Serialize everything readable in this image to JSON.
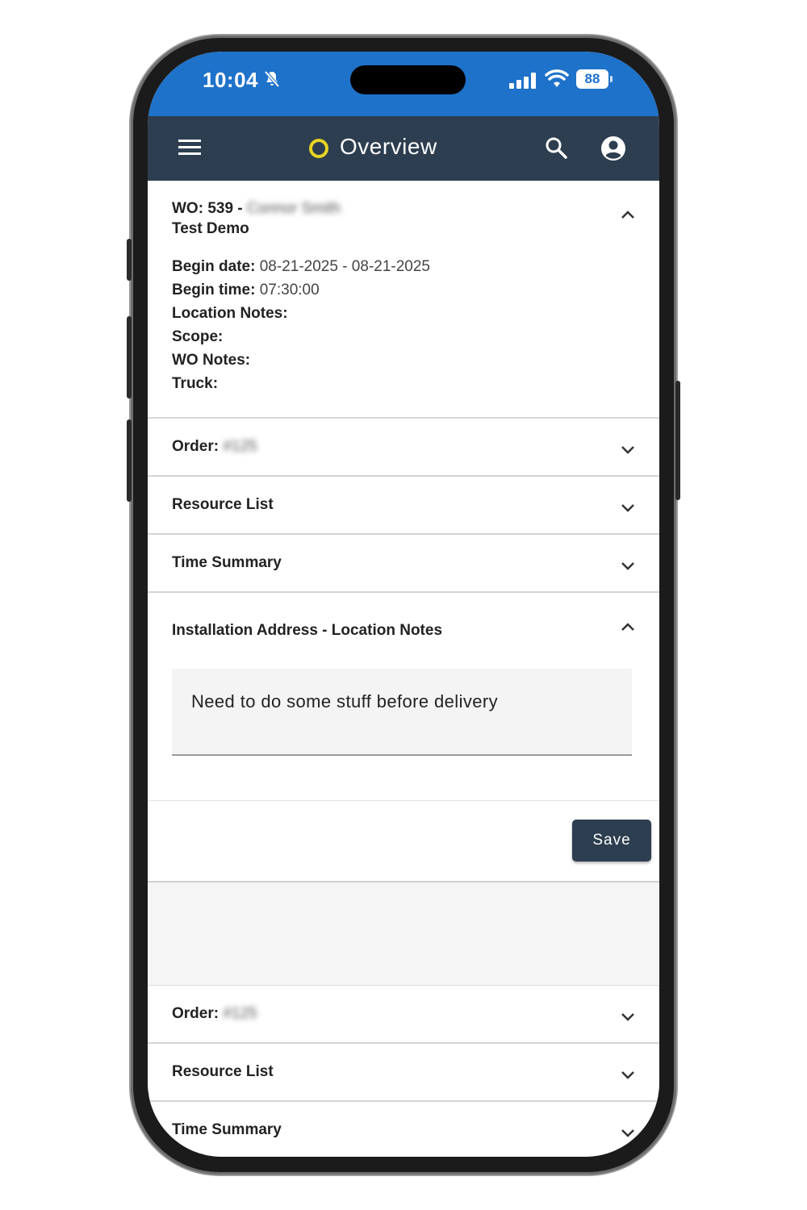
{
  "status_bar": {
    "time": "10:04",
    "battery": "88",
    "icons": [
      "bell-slash-icon",
      "signal-icon",
      "wifi-icon",
      "battery-icon"
    ]
  },
  "app_bar": {
    "title": "Overview",
    "icons": [
      "menu-icon",
      "logo-ring-icon",
      "search-icon",
      "account-icon"
    ],
    "logo_color": "#e7d422",
    "background": "#2d3e50"
  },
  "work_order": {
    "wo_label": "WO: 539 - ",
    "customer_name": "Connor Smith",
    "job_name": "Test Demo",
    "fields": [
      {
        "label": "Begin date:",
        "value": "08-21-2025 - 08-21-2025"
      },
      {
        "label": "Begin time:",
        "value": "07:30:00"
      },
      {
        "label": "Location Notes:",
        "value": ""
      },
      {
        "label": "Scope:",
        "value": ""
      },
      {
        "label": "WO Notes:",
        "value": ""
      },
      {
        "label": "Truck:",
        "value": ""
      }
    ]
  },
  "sections": {
    "order_label": "Order:",
    "order_number": "#125",
    "resource_list": "Resource List",
    "time_summary": "Time Summary",
    "installation_address": "Installation Address - Location Notes"
  },
  "location_notes": {
    "value": "Need to do some stuff before delivery"
  },
  "save_label": "Save",
  "accent_color": "#1e72c9"
}
